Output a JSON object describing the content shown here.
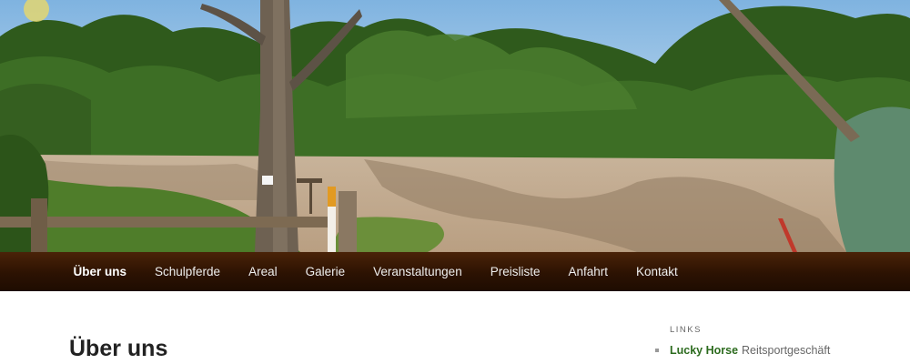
{
  "header": {
    "image": "riding-arena-photo"
  },
  "nav": {
    "items": [
      {
        "label": "Über uns",
        "active": true
      },
      {
        "label": "Schulpferde"
      },
      {
        "label": "Areal"
      },
      {
        "label": "Galerie"
      },
      {
        "label": "Veranstaltungen"
      },
      {
        "label": "Preisliste"
      },
      {
        "label": "Anfahrt"
      },
      {
        "label": "Kontakt"
      }
    ]
  },
  "main": {
    "title": "Über uns"
  },
  "sidebar": {
    "widget_title": "LINKS",
    "links": [
      {
        "name": "Lucky Horse",
        "desc": "Reitsportgeschäft"
      }
    ]
  },
  "colors": {
    "nav_bg": "#2c1202",
    "link_green": "#2c6b1e"
  }
}
